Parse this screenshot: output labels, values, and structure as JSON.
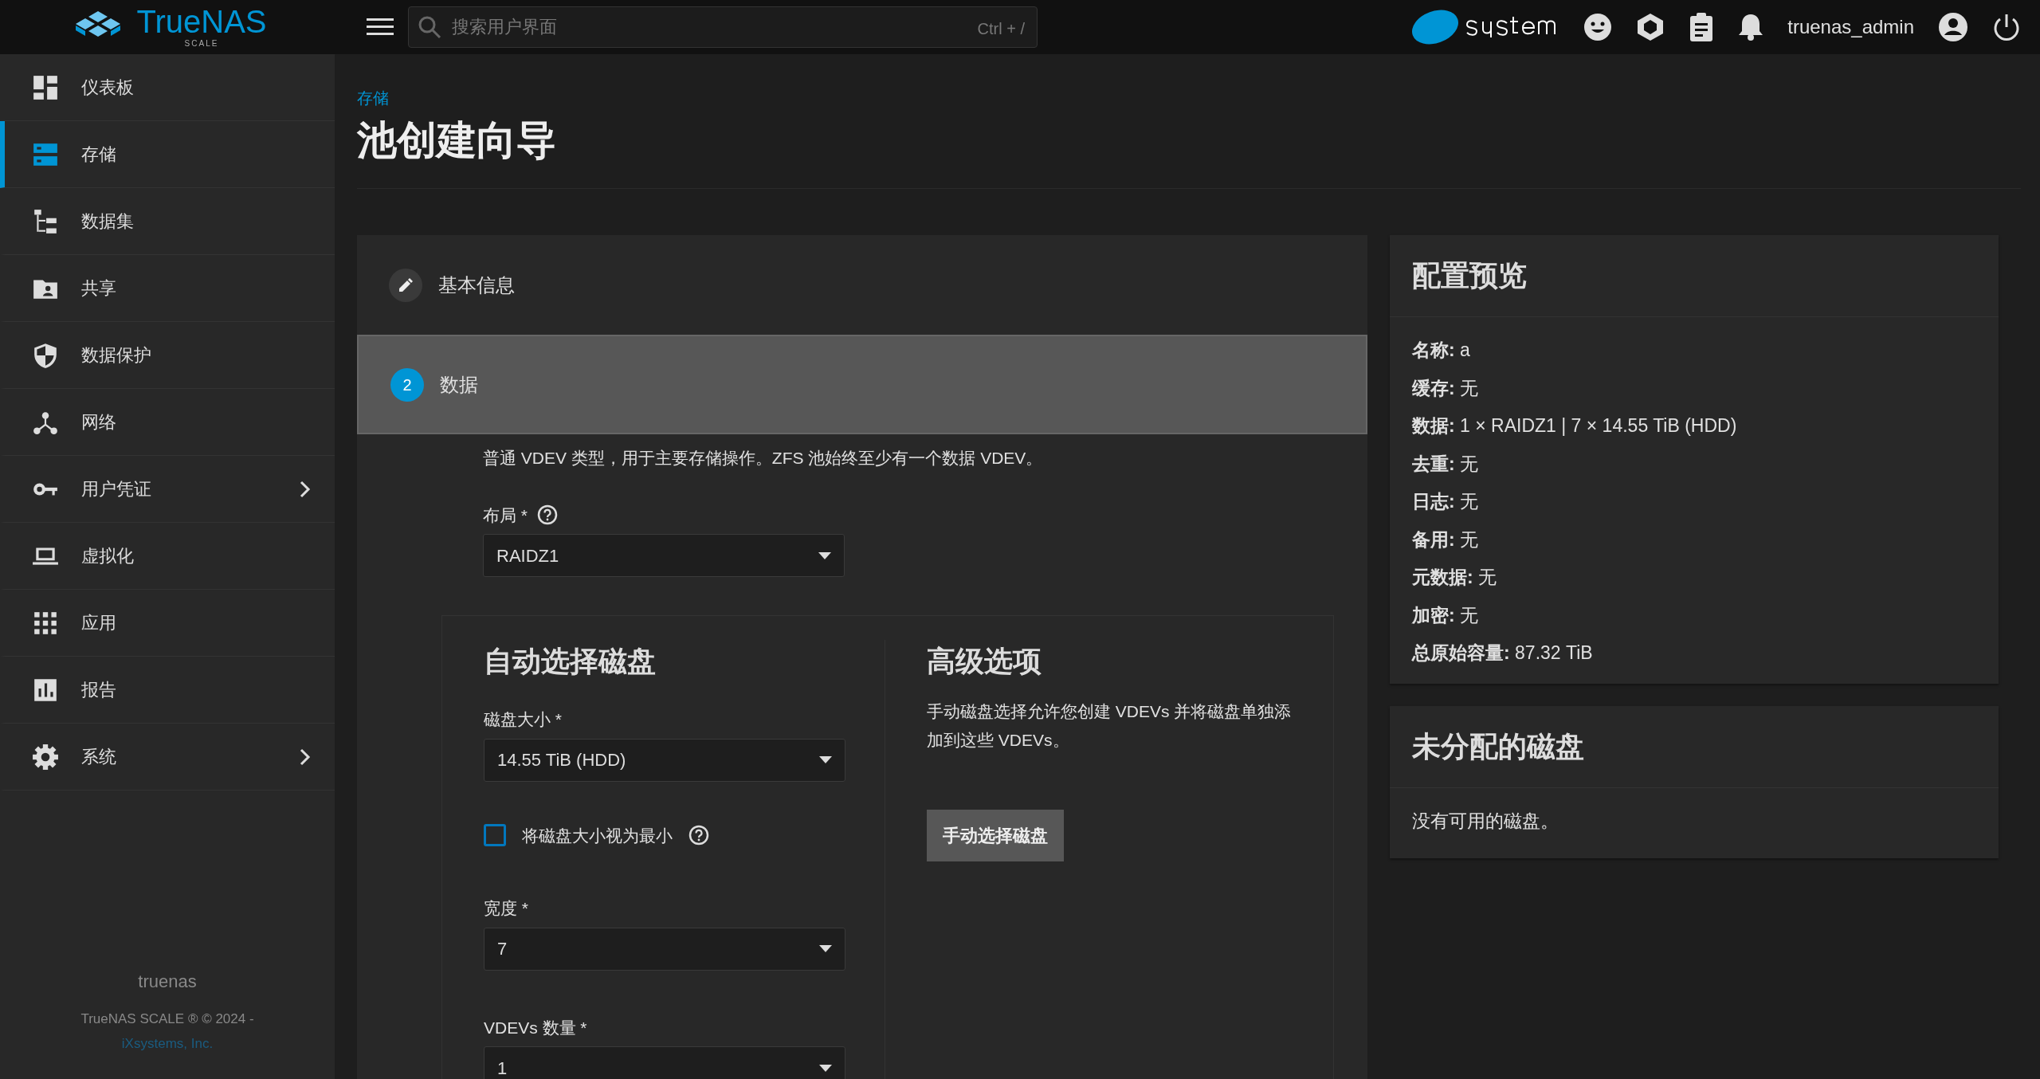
{
  "header": {
    "logo": "TrueNAS",
    "logo_edition": "SCALE",
    "search_placeholder": "搜索用户界面",
    "search_shortcut": "Ctrl + /",
    "username": "truenas_admin"
  },
  "sidebar": {
    "items": [
      {
        "label": "仪表板",
        "selected": false,
        "expandable": false
      },
      {
        "label": "存储",
        "selected": true,
        "expandable": false
      },
      {
        "label": "数据集",
        "selected": false,
        "expandable": false
      },
      {
        "label": "共享",
        "selected": false,
        "expandable": false
      },
      {
        "label": "数据保护",
        "selected": false,
        "expandable": false
      },
      {
        "label": "网络",
        "selected": false,
        "expandable": false
      },
      {
        "label": "用户凭证",
        "selected": false,
        "expandable": true
      },
      {
        "label": "虚拟化",
        "selected": false,
        "expandable": false
      },
      {
        "label": "应用",
        "selected": false,
        "expandable": false
      },
      {
        "label": "报告",
        "selected": false,
        "expandable": false
      },
      {
        "label": "系统",
        "selected": false,
        "expandable": true
      }
    ],
    "hostname": "truenas",
    "copyright": "TrueNAS SCALE ® © 2024 -",
    "company_link": "iXsystems, Inc."
  },
  "breadcrumb": "存储",
  "title": "池创建向导",
  "wizard": {
    "steps": [
      {
        "kind": "edit",
        "label": "基本信息",
        "active": false
      },
      {
        "kind": "number",
        "number": "2",
        "label": "数据",
        "active": true
      }
    ],
    "description": "普通 VDEV 类型，用于主要存储操作。ZFS 池始终至少有一个数据 VDEV。",
    "layout": {
      "label": "布局 *",
      "value": "RAIDZ1"
    },
    "auto": {
      "title": "自动选择磁盘",
      "disk_size": {
        "label": "磁盘大小 *",
        "value": "14.55 TiB (HDD)"
      },
      "checkbox": {
        "label": "将磁盘大小视为最小",
        "checked": false
      },
      "width": {
        "label": "宽度 *",
        "value": "7"
      },
      "vdevs": {
        "label": "VDEVs 数量 *",
        "value": "1"
      }
    },
    "advanced": {
      "title": "高级选项",
      "description": "手动磁盘选择允许您创建 VDEVs 并将磁盘单独添加到这些 VDEVs。",
      "button": "手动选择磁盘"
    }
  },
  "preview": {
    "title": "配置预览",
    "rows": [
      {
        "key": "名称:",
        "value": "a"
      },
      {
        "key": "缓存:",
        "value": "无"
      },
      {
        "key": "数据:",
        "value": "1 × RAIDZ1 | 7 × 14.55 TiB (HDD)"
      },
      {
        "key": "去重:",
        "value": "无"
      },
      {
        "key": "日志:",
        "value": "无"
      },
      {
        "key": "备用:",
        "value": "无"
      },
      {
        "key": "元数据:",
        "value": "无"
      },
      {
        "key": "加密:",
        "value": "无"
      },
      {
        "key": "总原始容量:",
        "value": "87.32 TiB"
      }
    ]
  },
  "unassigned": {
    "title": "未分配的磁盘",
    "message": "没有可用的磁盘。"
  }
}
